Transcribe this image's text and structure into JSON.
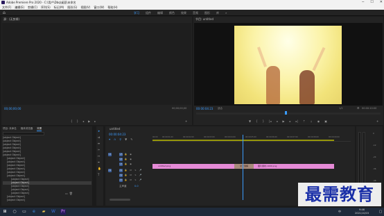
{
  "window": {
    "title": "Adobe Premiere Pro 2020 - C:\\用户\\Dbq\\桌面\\未命名",
    "controls": [
      "─",
      "☐",
      "✕"
    ]
  },
  "menubar": [
    "文件(F)",
    "编辑(E)",
    "剪辑(C)",
    "序列(S)",
    "标记(M)",
    "图形(G)",
    "视图(V)",
    "窗口(W)",
    "帮助(H)"
  ],
  "workspaces": {
    "tabs": [
      "学习",
      "组件",
      "编辑",
      "颜色",
      "效果",
      "音频",
      "图形",
      "库"
    ],
    "active_index": 0,
    "more": "»"
  },
  "source_monitor": {
    "title": "源：(无剪辑)",
    "timecode_left": "00;00;00;00",
    "timecode_right": "00;00;00;00"
  },
  "program_monitor": {
    "title": "节目: untitled",
    "timecode": "00:00:04:23",
    "fit_label": "适合",
    "quality": "1/2",
    "duration": "00:00:10:00"
  },
  "project_panel": {
    "tabs": [
      "项目: 未命名",
      "媒体浏览器",
      "库",
      "信息",
      "效果",
      "标记",
      "历史记录"
    ],
    "active_tab": "效果",
    "items": [
      {
        "label": "预设",
        "indent": 0
      },
      {
        "label": "Lumetri 预设",
        "indent": 0
      },
      {
        "label": "音频效果",
        "indent": 0
      },
      {
        "label": "音频过渡",
        "indent": 0
      },
      {
        "label": "视频效果",
        "indent": 0
      },
      {
        "label": "视频过渡",
        "indent": 0
      },
      {
        "label": "3D 运动",
        "indent": 1
      },
      {
        "label": "内滑",
        "indent": 1
      },
      {
        "label": "划像",
        "indent": 1
      },
      {
        "label": "擦除",
        "indent": 1
      },
      {
        "label": "沉浸式视频",
        "indent": 1
      },
      {
        "label": "溶解",
        "indent": 1
      },
      {
        "label": "MorphCut",
        "indent": 2
      },
      {
        "label": "交叉溶解",
        "indent": 2
      },
      {
        "label": "叠加溶解",
        "indent": 2
      },
      {
        "label": "白场过渡",
        "indent": 2
      },
      {
        "label": "黑场过渡",
        "indent": 2
      },
      {
        "label": "缩放",
        "indent": 1
      },
      {
        "label": "页面剥落",
        "indent": 1
      }
    ],
    "selected_index": 13
  },
  "timeline": {
    "title": "untitled",
    "timecode": "00:00:04:23",
    "ruler": [
      "00:00",
      "00:00:01:00",
      "00:00:02:00",
      "00:00:03:00",
      "00:00:04:00",
      "00:00:05:00",
      "00:00:06:00",
      "00:00:07:00",
      "00:00:08:00",
      "00:00:09:00"
    ],
    "tracks": [
      "V3",
      "V2",
      "V1",
      "A1",
      "A2",
      "A3"
    ],
    "master_label": "主声道",
    "master_value": "0.0",
    "clips": [
      {
        "label": "untitled.png",
        "track": "V1"
      },
      {
        "label": "交叉溶解",
        "track": "V1"
      },
      {
        "label": "图片素材-1000.png",
        "track": "V1"
      }
    ]
  },
  "audio_meter": {
    "scale": [
      "0",
      "-12",
      "-24",
      "-36",
      "-48",
      "dB"
    ]
  },
  "watermark": "最需教育",
  "taskbar": {
    "time": "9:46",
    "date": "2021/10/15",
    "lang": "中"
  },
  "colors": {
    "accent": "#3b9cff",
    "clip": "#e58ad6",
    "playhead": "#3b9cff"
  }
}
